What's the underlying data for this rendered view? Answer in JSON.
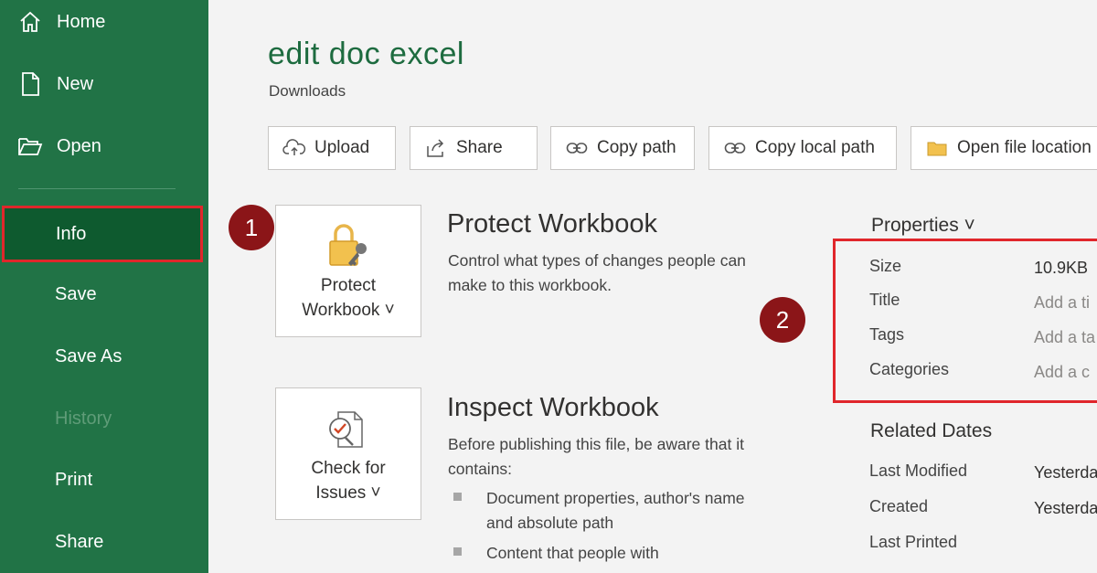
{
  "sidebar": {
    "items": [
      {
        "label": "Home",
        "icon": "home-icon"
      },
      {
        "label": "New",
        "icon": "new-document-icon"
      },
      {
        "label": "Open",
        "icon": "open-folder-icon"
      },
      {
        "label": "Info"
      },
      {
        "label": "Save"
      },
      {
        "label": "Save As"
      },
      {
        "label": "History"
      },
      {
        "label": "Print"
      },
      {
        "label": "Share"
      }
    ]
  },
  "document": {
    "title": "edit doc excel",
    "location": "Downloads"
  },
  "toolbar": {
    "upload": "Upload",
    "share": "Share",
    "copy_path": "Copy path",
    "copy_local_path": "Copy local path",
    "open_file_location": "Open file location"
  },
  "protect": {
    "button_line1": "Protect",
    "button_line2": "Workbook ˅",
    "title": "Protect Workbook",
    "description": "Control what types of changes people can make to this workbook."
  },
  "inspect": {
    "button_line1": "Check for",
    "button_line2": "Issues ˅",
    "title": "Inspect Workbook",
    "description": "Before publishing this file, be aware that it contains:",
    "bullets": [
      "Document properties, author's name and absolute path",
      "Content that people with"
    ]
  },
  "badges": [
    "1",
    "2"
  ],
  "properties": {
    "header": "Properties ˅",
    "rows": [
      {
        "key": "Size",
        "value": "10.9KB"
      },
      {
        "key": "Title",
        "value": "Add a ti"
      },
      {
        "key": "Tags",
        "value": "Add a ta"
      },
      {
        "key": "Categories",
        "value": "Add a c"
      }
    ]
  },
  "related_dates": {
    "header": "Related Dates",
    "rows": [
      {
        "key": "Last Modified",
        "value": "Yesterda"
      },
      {
        "key": "Created",
        "value": "Yesterda"
      },
      {
        "key": "Last Printed",
        "value": ""
      }
    ]
  },
  "colors": {
    "sidebar_bg": "#217346",
    "selected_bg": "#0e5a2f",
    "highlight_border": "#e0262b",
    "badge": "#8b1518",
    "title_green": "#1d6b3f"
  }
}
